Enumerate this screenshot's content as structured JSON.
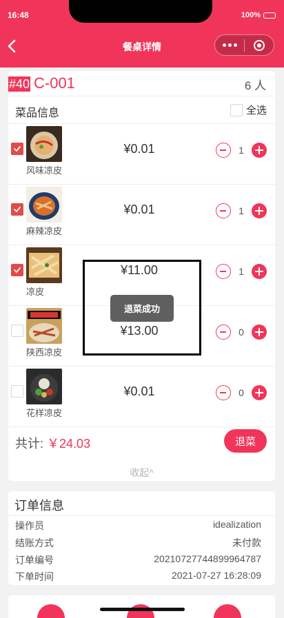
{
  "status_bar": {
    "time": "16:48",
    "battery": "100%"
  },
  "nav": {
    "title": "餐桌详情"
  },
  "table": {
    "number": "#40",
    "code": "C-001",
    "people": "6 人"
  },
  "dishes": {
    "header": "菜品信息",
    "select_all": "全选",
    "items": [
      {
        "name": "风味凉皮",
        "price": "¥0.01",
        "qty": "1",
        "checked": true
      },
      {
        "name": "麻辣凉皮",
        "price": "¥0.01",
        "qty": "1",
        "checked": true
      },
      {
        "name": "凉皮",
        "price": "¥11.00",
        "qty": "1",
        "checked": true
      },
      {
        "name": "陕西凉皮",
        "price": "¥13.00",
        "qty": "0",
        "checked": false
      },
      {
        "name": "花样凉皮",
        "price": "¥0.01",
        "qty": "0",
        "checked": false
      }
    ]
  },
  "summary": {
    "total_label": "共计:",
    "total_value": "￥24.03",
    "refund_button": "退菜",
    "collapse": "收起^"
  },
  "toast": {
    "message": "退菜成功"
  },
  "order": {
    "title": "订单信息",
    "rows": [
      {
        "key": "操作员",
        "value": "idealization"
      },
      {
        "key": "结账方式",
        "value": "未付款"
      },
      {
        "key": "订单编号",
        "value": "20210727744899964787"
      },
      {
        "key": "下单时间",
        "value": "2021-07-27 16:28:09"
      }
    ]
  },
  "colors": {
    "brand": "#f1355a",
    "checkbox": "#e34a4a"
  }
}
